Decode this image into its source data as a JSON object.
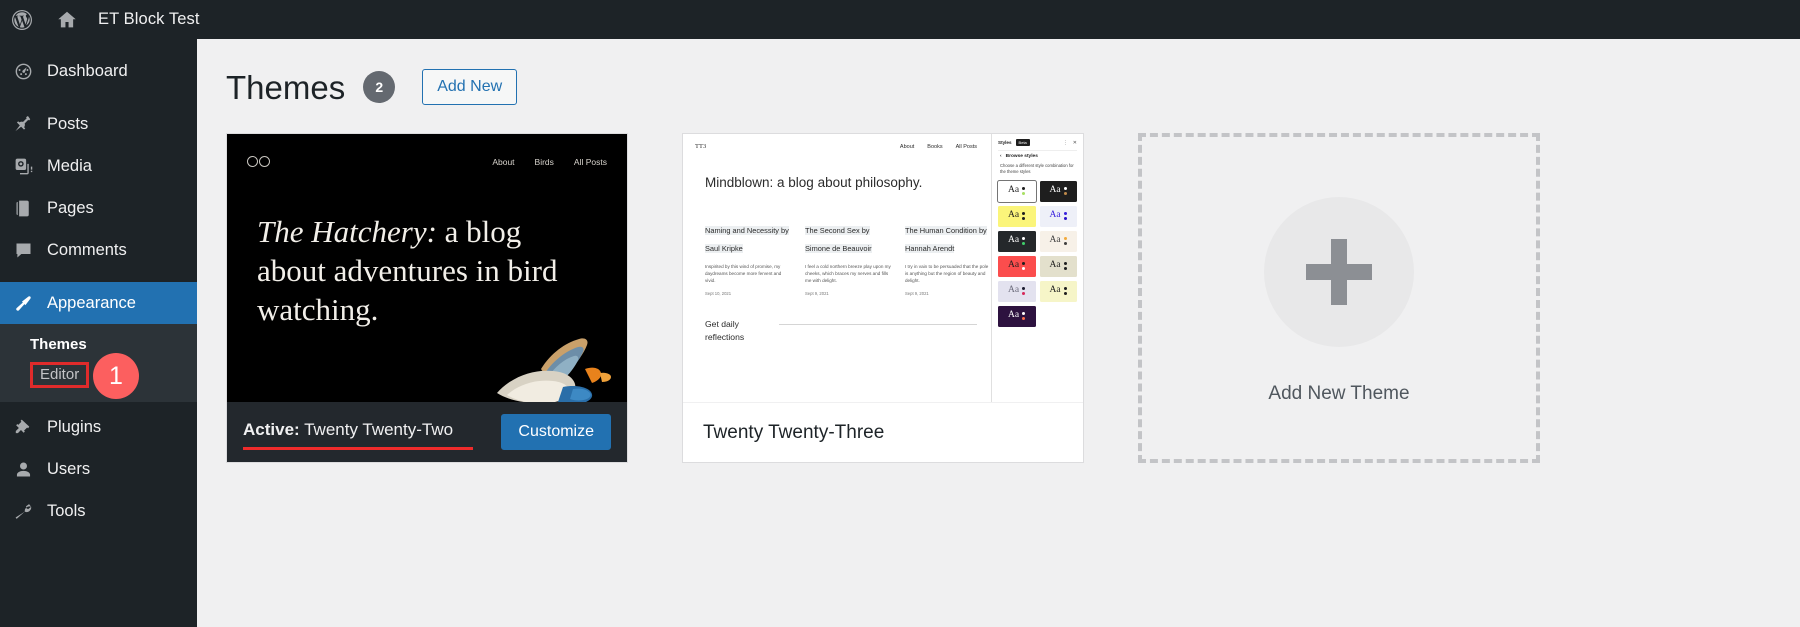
{
  "adminbar": {
    "logo_icon": "wordpress-logo-icon",
    "home_icon": "home-icon",
    "site_name": "ET Block Test"
  },
  "sidebar": {
    "items": [
      {
        "label": "Dashboard",
        "icon": "dashboard-icon",
        "current": false
      },
      {
        "label": "Posts",
        "icon": "pin-icon",
        "current": false
      },
      {
        "label": "Media",
        "icon": "media-icon",
        "current": false
      },
      {
        "label": "Pages",
        "icon": "pages-icon",
        "current": false
      },
      {
        "label": "Comments",
        "icon": "comments-icon",
        "current": false
      },
      {
        "label": "Appearance",
        "icon": "paintbrush-icon",
        "current": true
      },
      {
        "label": "Plugins",
        "icon": "plugins-icon",
        "current": false
      },
      {
        "label": "Users",
        "icon": "users-icon",
        "current": false
      },
      {
        "label": "Tools",
        "icon": "wrench-icon",
        "current": false
      }
    ],
    "submenu": [
      {
        "label": "Themes",
        "active": true
      },
      {
        "label": "Editor",
        "active": false,
        "highlighted": true
      }
    ],
    "step_badge": "1"
  },
  "page": {
    "title": "Themes",
    "count": "2",
    "add_new_label": "Add New"
  },
  "themes": [
    {
      "name": "Twenty Twenty-Two",
      "active_prefix": "Active:",
      "active_name": "Twenty Twenty-Two",
      "customize_label": "Customize",
      "preview": {
        "logo_icon": "two-circles-logo-icon",
        "nav": [
          "About",
          "Birds",
          "All Posts"
        ],
        "heading_italic": "The Hatchery:",
        "heading_rest": " a blog about adventures in bird watching."
      }
    },
    {
      "name": "Twenty Twenty-Three",
      "preview": {
        "logo": "TT3",
        "nav": [
          "About",
          "Books",
          "All Posts"
        ],
        "hero": "Mindblown: a blog about philosophy.",
        "posts": [
          {
            "title": "Naming and Necessity by Saul Kripke",
            "excerpt": "Inspirited by this wind of promise, my daydreams become more fervent and vivid.",
            "date": "Sept 10, 2021"
          },
          {
            "title": "The Second Sex by Simone de Beauvoir",
            "excerpt": "I feel a cold northern breeze play upon my cheeks, which braces my nerves and fills me with delight.",
            "date": "Sept 9, 2021"
          },
          {
            "title": "The Human Condition by Hannah Arendt",
            "excerpt": "I try in vain to be persuaded that the pole is anything but the region of beauty and delight.",
            "date": "Sept 9, 2021"
          }
        ],
        "footer_cta": "Get daily reflections",
        "styles_panel": {
          "title": "Styles",
          "beta": "Beta",
          "more_icon": "kebab-menu-icon",
          "close_icon": "close-icon",
          "back_icon": "chevron-left-icon",
          "subtitle": "Browse styles",
          "description": "Choose a different style combination for the theme styles",
          "swatches": [
            {
              "bg": "#ffffff",
              "fg": "#1e1e1e",
              "dot_top": "#1e1e1e",
              "dot_bottom": "#a8e063",
              "selected": true
            },
            {
              "bg": "#1e1e1e",
              "fg": "#ffffff",
              "dot_top": "#ffffff",
              "dot_bottom": "#c08a4a",
              "selected": false
            },
            {
              "bg": "#fbf57a",
              "fg": "#1e1e1e",
              "dot_top": "#1e1e1e",
              "dot_bottom": "#1e1e1e",
              "selected": false
            },
            {
              "bg": "#eef0f8",
              "fg": "#3a22dd",
              "dot_top": "#3a22dd",
              "dot_bottom": "#2911c9",
              "selected": false
            },
            {
              "bg": "#24282b",
              "fg": "#ffffff",
              "dot_top": "#ffffff",
              "dot_bottom": "#3fcf6b",
              "selected": false
            },
            {
              "bg": "#f7f1e8",
              "fg": "#3f3f3f",
              "dot_top": "#f2a93b",
              "dot_bottom": "#3f3f3f",
              "selected": false
            },
            {
              "bg": "#fb4d4d",
              "fg": "#1e1e1e",
              "dot_top": "#1e1e1e",
              "dot_bottom": "#ffffff",
              "selected": false
            },
            {
              "bg": "#e3e0cc",
              "fg": "#1e1e1e",
              "dot_top": "#1e1e1e",
              "dot_bottom": "#1e1e1e",
              "selected": false
            },
            {
              "bg": "#e3e2ef",
              "fg": "#6b6b7b",
              "dot_top": "#1a1a2e",
              "dot_bottom": "#d6285a",
              "selected": false
            },
            {
              "bg": "#f6f5c8",
              "fg": "#1e1e1e",
              "dot_top": "#1e1e1e",
              "dot_bottom": "#1e1e1e",
              "selected": false
            },
            {
              "bg": "#2d123f",
              "fg": "#ffffff",
              "dot_top": "#ffffff",
              "dot_bottom": "#ff6b4a",
              "selected": false
            }
          ]
        }
      }
    }
  ],
  "add_theme": {
    "label": "Add New Theme",
    "icon": "plus-icon"
  },
  "colors": {
    "admin_bg": "#1d2327",
    "accent": "#2271b1",
    "highlight_red": "#e02b2b",
    "badge_red": "#fc5f5f",
    "content_bg": "#f0f0f1"
  }
}
